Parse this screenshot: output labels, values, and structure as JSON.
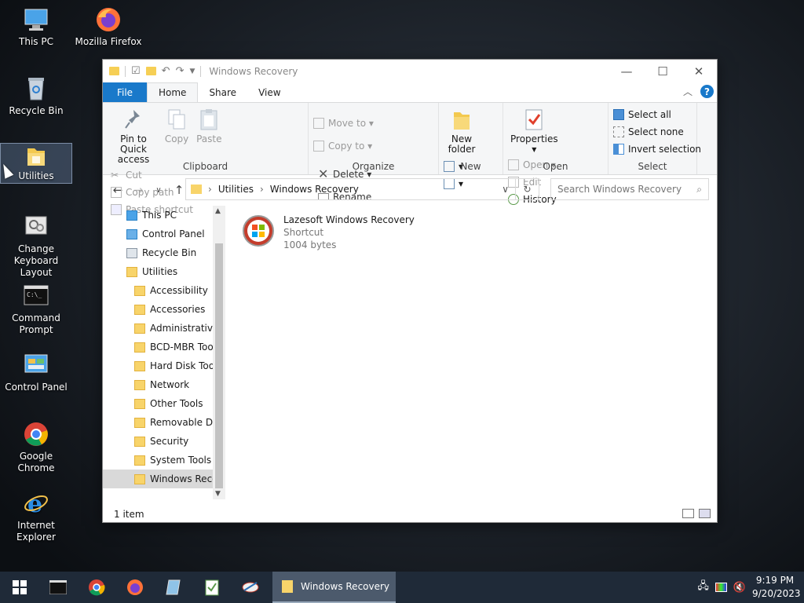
{
  "desktop": {
    "icons": [
      {
        "label": "This PC"
      },
      {
        "label": "Mozilla Firefox"
      },
      {
        "label": "Recycle Bin"
      },
      {
        "label": "Utilities"
      },
      {
        "label": "Change Keyboard Layout"
      },
      {
        "label": "Command Prompt"
      },
      {
        "label": "Control Panel"
      },
      {
        "label": "Google Chrome"
      },
      {
        "label": "Internet Explorer"
      }
    ]
  },
  "window": {
    "title": "Windows Recovery",
    "tabs": [
      "File",
      "Home",
      "Share",
      "View"
    ],
    "ribbon": {
      "clipboard": {
        "label": "Clipboard",
        "pin": "Pin to Quick access",
        "copy": "Copy",
        "paste": "Paste",
        "cut": "Cut",
        "copy_path": "Copy path",
        "paste_shortcut": "Paste shortcut"
      },
      "organize": {
        "label": "Organize",
        "move_to": "Move to",
        "copy_to": "Copy to",
        "delete": "Delete",
        "rename": "Rename"
      },
      "new": {
        "label": "New",
        "new_folder": "New folder"
      },
      "open": {
        "label": "Open",
        "properties": "Properties",
        "open": "Open",
        "edit": "Edit",
        "history": "History"
      },
      "select": {
        "label": "Select",
        "select_all": "Select all",
        "select_none": "Select none",
        "invert": "Invert selection"
      }
    },
    "address": {
      "crumbs": [
        "Utilities",
        "Windows Recovery"
      ]
    },
    "search": {
      "placeholder": "Search Windows Recovery"
    },
    "tree": [
      {
        "label": "This PC"
      },
      {
        "label": "Control Panel"
      },
      {
        "label": "Recycle Bin"
      },
      {
        "label": "Utilities"
      },
      {
        "label": "Accessibility"
      },
      {
        "label": "Accessories"
      },
      {
        "label": "Administrative"
      },
      {
        "label": "BCD-MBR Tool"
      },
      {
        "label": "Hard Disk Tools"
      },
      {
        "label": "Network"
      },
      {
        "label": "Other Tools"
      },
      {
        "label": "Removable Dri"
      },
      {
        "label": "Security"
      },
      {
        "label": "System Tools"
      },
      {
        "label": "Windows Reco"
      }
    ],
    "files": [
      {
        "name": "Lazesoft Windows Recovery",
        "type": "Shortcut",
        "size": "1004 bytes"
      }
    ],
    "status": "1 item"
  },
  "taskbar": {
    "active_app": "Windows Recovery",
    "time": "9:19 PM",
    "date": "9/20/2023"
  },
  "colors": {
    "accent": "#1979ca",
    "folder": "#f8d46a",
    "taskbar": "#1f2a38"
  }
}
